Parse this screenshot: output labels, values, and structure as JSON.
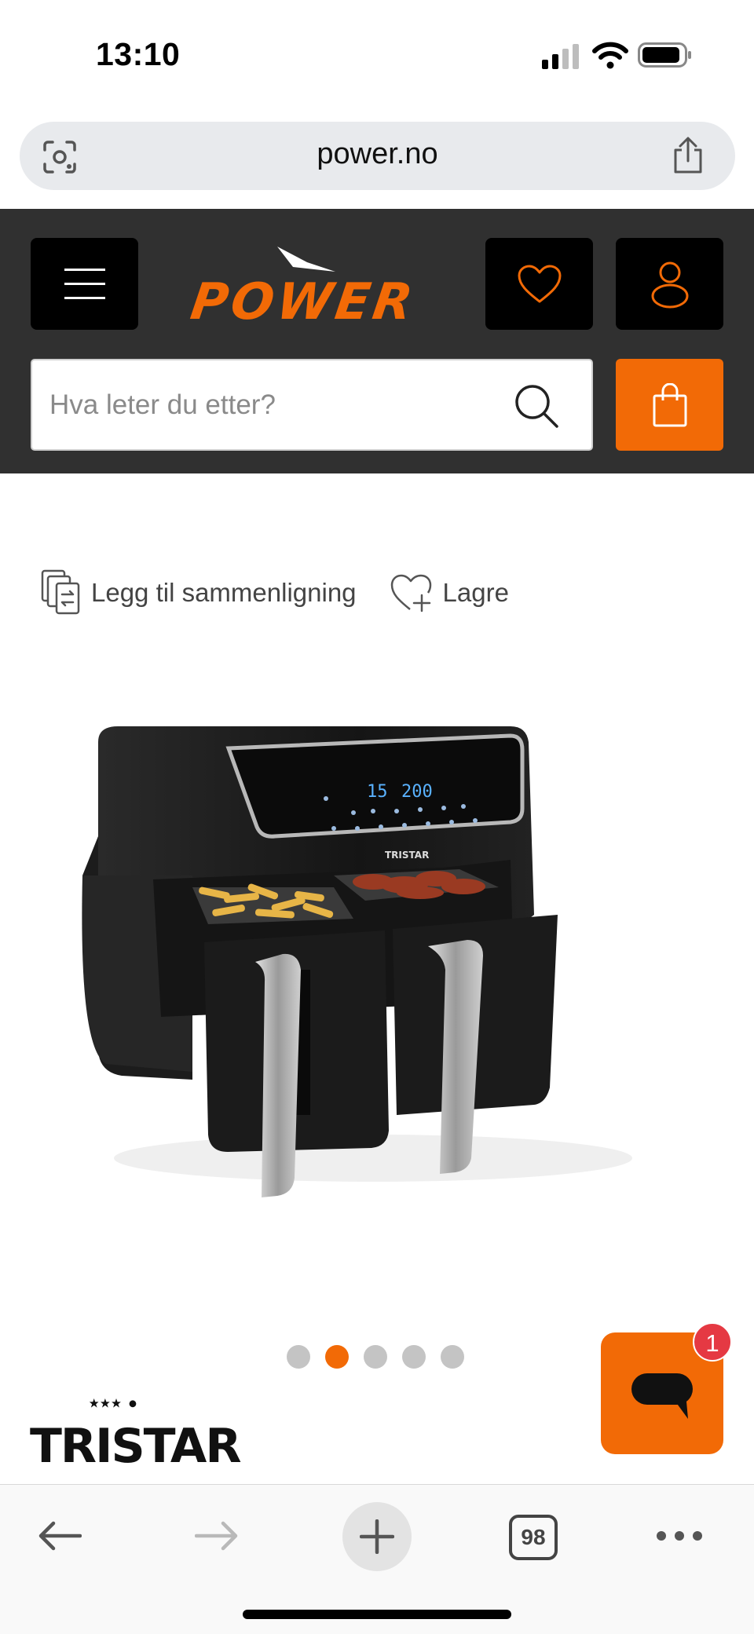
{
  "status_bar": {
    "time": "13:10",
    "icons": [
      "signal-icon",
      "wifi-icon",
      "battery-icon"
    ]
  },
  "url_bar": {
    "url": "power.no",
    "icons": [
      "lens-icon",
      "share-icon"
    ]
  },
  "header": {
    "logo_text": "POWER",
    "buttons": [
      "menu-icon",
      "heart-icon",
      "user-icon"
    ],
    "search": {
      "placeholder": "Hva leter du etter?",
      "value": ""
    },
    "cart_icon": "shopping-bag-icon"
  },
  "actions": {
    "compare_label": "Legg til sammenligning",
    "save_label": "Lagre"
  },
  "product": {
    "image_alt": "Tristar airfryer med to kurver",
    "display_time": "15",
    "display_temp": "200",
    "device_brand": "TRISTAR"
  },
  "carousel": {
    "count": 5,
    "active_index": 1
  },
  "brand": {
    "name": "TRISTAR"
  },
  "chat": {
    "badge_count": "1"
  },
  "browser_bar": {
    "tabs_count": "98"
  },
  "colors": {
    "accent": "#f26a06",
    "header_bg": "#303030",
    "badge": "#e53943"
  }
}
